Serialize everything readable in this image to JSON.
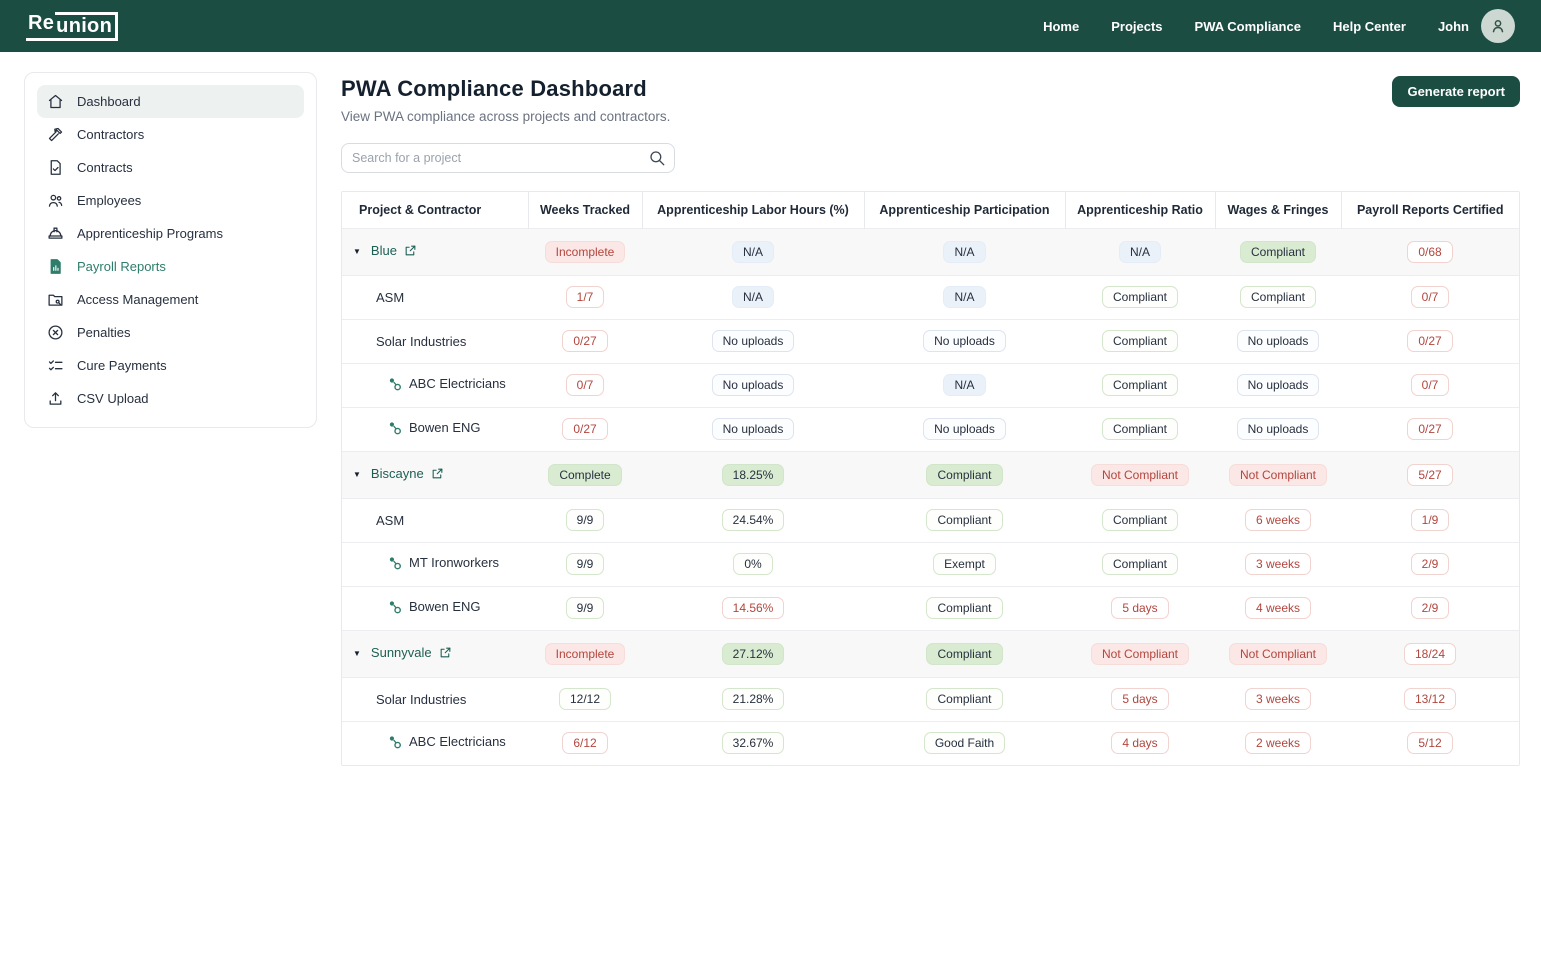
{
  "topnav": {
    "logo_re": "Re",
    "logo_union": "union",
    "items": [
      {
        "label": "Home"
      },
      {
        "label": "Projects"
      },
      {
        "label": "PWA Compliance"
      },
      {
        "label": "Help Center"
      }
    ],
    "user": "John"
  },
  "sidebar": {
    "items": [
      {
        "label": "Dashboard"
      },
      {
        "label": "Contractors"
      },
      {
        "label": "Contracts"
      },
      {
        "label": "Employees"
      },
      {
        "label": "Apprenticeship Programs"
      },
      {
        "label": "Payroll Reports"
      },
      {
        "label": "Access Management"
      },
      {
        "label": "Penalties"
      },
      {
        "label": "Cure Payments"
      },
      {
        "label": "CSV Upload"
      }
    ]
  },
  "header": {
    "title": "PWA Compliance Dashboard",
    "subtitle": "View PWA compliance across projects and contractors.",
    "search_placeholder": "Search for a project",
    "generate_button": "Generate report"
  },
  "table": {
    "columns": [
      "Project & Contractor",
      "Weeks Tracked",
      "Apprenticeship Labor Hours (%)",
      "Apprenticeship Participation",
      "Apprenticeship Ratio",
      "Wages & Fringes",
      "Payroll Reports Certified"
    ],
    "rows": [
      {
        "type": "project",
        "name": "Blue",
        "cells": [
          {
            "text": "Incomplete",
            "style": "pink"
          },
          {
            "text": "N/A",
            "style": "blue"
          },
          {
            "text": "N/A",
            "style": "blue"
          },
          {
            "text": "N/A",
            "style": "blue"
          },
          {
            "text": "Compliant",
            "style": "green"
          },
          {
            "text": "0/68",
            "style": "outline-red"
          }
        ]
      },
      {
        "type": "contractor",
        "name": "ASM",
        "cells": [
          {
            "text": "1/7",
            "style": "outline-red"
          },
          {
            "text": "N/A",
            "style": "blue"
          },
          {
            "text": "N/A",
            "style": "blue"
          },
          {
            "text": "Compliant",
            "style": "outline-green"
          },
          {
            "text": "Compliant",
            "style": "outline-green"
          },
          {
            "text": "0/7",
            "style": "outline-red"
          }
        ]
      },
      {
        "type": "contractor",
        "name": "Solar Industries",
        "cells": [
          {
            "text": "0/27",
            "style": "outline-red"
          },
          {
            "text": "No uploads",
            "style": "outline-gray"
          },
          {
            "text": "No uploads",
            "style": "outline-gray"
          },
          {
            "text": "Compliant",
            "style": "outline-green"
          },
          {
            "text": "No uploads",
            "style": "outline-gray"
          },
          {
            "text": "0/27",
            "style": "outline-red"
          }
        ]
      },
      {
        "type": "subcontractor",
        "name": "ABC Electricians",
        "cells": [
          {
            "text": "0/7",
            "style": "outline-red"
          },
          {
            "text": "No uploads",
            "style": "outline-gray"
          },
          {
            "text": "N/A",
            "style": "blue"
          },
          {
            "text": "Compliant",
            "style": "outline-green"
          },
          {
            "text": "No uploads",
            "style": "outline-gray"
          },
          {
            "text": "0/7",
            "style": "outline-red"
          }
        ]
      },
      {
        "type": "subcontractor",
        "name": "Bowen ENG",
        "cells": [
          {
            "text": "0/27",
            "style": "outline-red"
          },
          {
            "text": "No uploads",
            "style": "outline-gray"
          },
          {
            "text": "No uploads",
            "style": "outline-gray"
          },
          {
            "text": "Compliant",
            "style": "outline-green"
          },
          {
            "text": "No uploads",
            "style": "outline-gray"
          },
          {
            "text": "0/27",
            "style": "outline-red"
          }
        ]
      },
      {
        "type": "project",
        "name": "Biscayne",
        "cells": [
          {
            "text": "Complete",
            "style": "green"
          },
          {
            "text": "18.25%",
            "style": "green"
          },
          {
            "text": "Compliant",
            "style": "green"
          },
          {
            "text": "Not Compliant",
            "style": "pink"
          },
          {
            "text": "Not Compliant",
            "style": "pink"
          },
          {
            "text": "5/27",
            "style": "outline-red"
          }
        ]
      },
      {
        "type": "contractor",
        "name": "ASM",
        "cells": [
          {
            "text": "9/9",
            "style": "outline-green"
          },
          {
            "text": "24.54%",
            "style": "outline-green"
          },
          {
            "text": "Compliant",
            "style": "outline-green"
          },
          {
            "text": "Compliant",
            "style": "outline-green"
          },
          {
            "text": "6 weeks",
            "style": "outline-red"
          },
          {
            "text": "1/9",
            "style": "outline-red"
          }
        ]
      },
      {
        "type": "subcontractor",
        "name": "MT Ironworkers",
        "cells": [
          {
            "text": "9/9",
            "style": "outline-green"
          },
          {
            "text": "0%",
            "style": "outline-green"
          },
          {
            "text": "Exempt",
            "style": "outline-green"
          },
          {
            "text": "Compliant",
            "style": "outline-green"
          },
          {
            "text": "3 weeks",
            "style": "outline-red"
          },
          {
            "text": "2/9",
            "style": "outline-red"
          }
        ]
      },
      {
        "type": "subcontractor",
        "name": "Bowen ENG",
        "cells": [
          {
            "text": "9/9",
            "style": "outline-green"
          },
          {
            "text": "14.56%",
            "style": "outline-red"
          },
          {
            "text": "Compliant",
            "style": "outline-green"
          },
          {
            "text": "5 days",
            "style": "outline-red"
          },
          {
            "text": "4 weeks",
            "style": "outline-red"
          },
          {
            "text": "2/9",
            "style": "outline-red"
          }
        ]
      },
      {
        "type": "project",
        "name": "Sunnyvale",
        "cells": [
          {
            "text": "Incomplete",
            "style": "pink"
          },
          {
            "text": "27.12%",
            "style": "green"
          },
          {
            "text": "Compliant",
            "style": "green"
          },
          {
            "text": "Not Compliant",
            "style": "pink"
          },
          {
            "text": "Not Compliant",
            "style": "pink"
          },
          {
            "text": "18/24",
            "style": "outline-red"
          }
        ]
      },
      {
        "type": "contractor",
        "name": "Solar Industries",
        "cells": [
          {
            "text": "12/12",
            "style": "outline-green"
          },
          {
            "text": "21.28%",
            "style": "outline-green"
          },
          {
            "text": "Compliant",
            "style": "outline-green"
          },
          {
            "text": "5 days",
            "style": "outline-red"
          },
          {
            "text": "3 weeks",
            "style": "outline-red"
          },
          {
            "text": "13/12",
            "style": "outline-red"
          }
        ]
      },
      {
        "type": "subcontractor",
        "name": "ABC Electricians",
        "cells": [
          {
            "text": "6/12",
            "style": "outline-red"
          },
          {
            "text": "32.67%",
            "style": "outline-green"
          },
          {
            "text": "Good Faith",
            "style": "outline-green"
          },
          {
            "text": "4 days",
            "style": "outline-red"
          },
          {
            "text": "2 weeks",
            "style": "outline-red"
          },
          {
            "text": "5/12",
            "style": "outline-red"
          }
        ]
      }
    ]
  },
  "colors": {
    "brand_green": "#1b4d43",
    "link_teal": "#1e5f54",
    "sidebar_highlight_teal": "#2e7d6b",
    "badge_red_text": "#b2463e",
    "badge_pink_bg": "#fbe7e5",
    "badge_green_bg": "#d9ecd2",
    "badge_blue_bg": "#eaf1f9"
  }
}
